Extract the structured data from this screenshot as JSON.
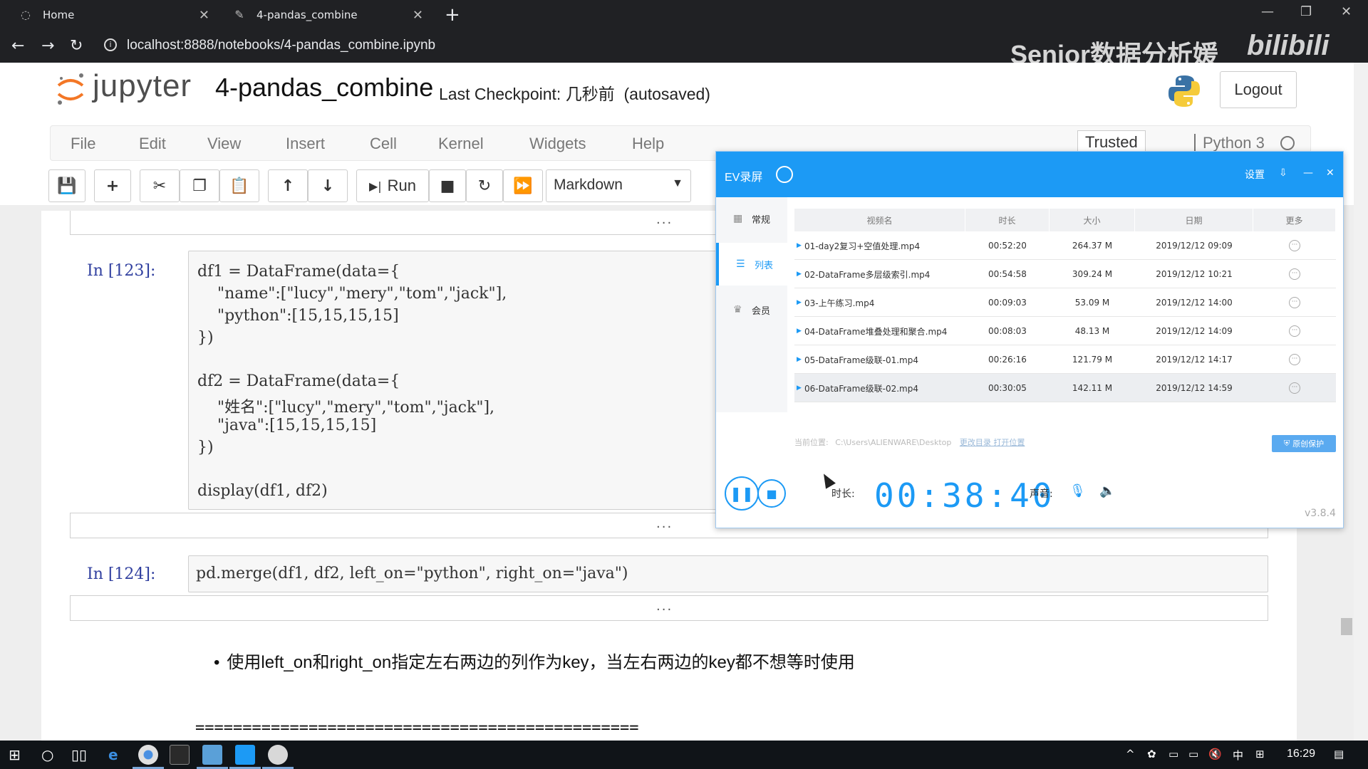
{
  "browser": {
    "tabs": [
      {
        "title": "Home"
      },
      {
        "title": "4-pandas_combine"
      }
    ],
    "url": "localhost:8888/notebooks/4-pandas_combine.ipynb",
    "watermark": "Senior数据分析媛",
    "brand": "bilibili"
  },
  "jupyter": {
    "logo_text": "jupyter",
    "notebook_title": "4-pandas_combine",
    "checkpoint": "Last Checkpoint: 几秒前  (autosaved)",
    "logout": "Logout",
    "menu": [
      "File",
      "Edit",
      "View",
      "Insert",
      "Cell",
      "Kernel",
      "Widgets",
      "Help"
    ],
    "trusted": "Trusted",
    "kernel": "Python 3",
    "run_label": "Run",
    "cell_type": "Markdown"
  },
  "cells": {
    "cell123": {
      "prompt": "In  [123]:",
      "lines": [
        "df1 = DataFrame(data={",
        "    \"name\":[\"lucy\",\"mery\",\"tom\",\"jack\"],",
        "    \"python\":[15,15,15,15]",
        "})",
        "",
        "df2 = DataFrame(data={",
        "    \"姓名\":[\"lucy\",\"mery\",\"tom\",\"jack\"],",
        "    \"java\":[15,15,15,15]",
        "})",
        "",
        "display(df1, df2)"
      ]
    },
    "cell124": {
      "prompt": "In  [124]:",
      "line": "pd.merge(df1, df2, left_on=\"python\", right_on=\"java\")"
    },
    "ellipsis": "...",
    "markdown_bullet": "使用left_on和right_on指定左右两边的列作为key，当左右两边的key都不想等时使用",
    "markdown_rule": "==============================================="
  },
  "ev": {
    "title": "EV录屏",
    "settings": "设置",
    "side": [
      "常规",
      "列表",
      "会员"
    ],
    "headers": [
      "视频名",
      "时长",
      "大小",
      "日期",
      "更多"
    ],
    "rows": [
      {
        "name": "01-day2复习+空值处理.mp4",
        "duration": "00:52:20",
        "size": "264.37 M",
        "date": "2019/12/12 09:09"
      },
      {
        "name": "02-DataFrame多层级索引.mp4",
        "duration": "00:54:58",
        "size": "309.24 M",
        "date": "2019/12/12 10:21"
      },
      {
        "name": "03-上午练习.mp4",
        "duration": "00:09:03",
        "size": "53.09 M",
        "date": "2019/12/12 14:00"
      },
      {
        "name": "04-DataFrame堆叠处理和聚合.mp4",
        "duration": "00:08:03",
        "size": "48.13 M",
        "date": "2019/12/12 14:09"
      },
      {
        "name": "05-DataFrame级联-01.mp4",
        "duration": "00:26:16",
        "size": "121.79 M",
        "date": "2019/12/12 14:17"
      },
      {
        "name": "06-DataFrame级联-02.mp4",
        "duration": "00:30:05",
        "size": "142.11 M",
        "date": "2019/12/12 14:59"
      }
    ],
    "location_label": "当前位置:",
    "location_path": "C:\\Users\\ALIENWARE\\Desktop",
    "location_links": "更改目录  打开位置",
    "protect": "原创保护",
    "duration_label": "时长:",
    "timer": "00:38:40",
    "sound_label": "声音:",
    "version": "v3.8.4"
  },
  "taskbar": {
    "time": "16:29",
    "ime": "中"
  }
}
